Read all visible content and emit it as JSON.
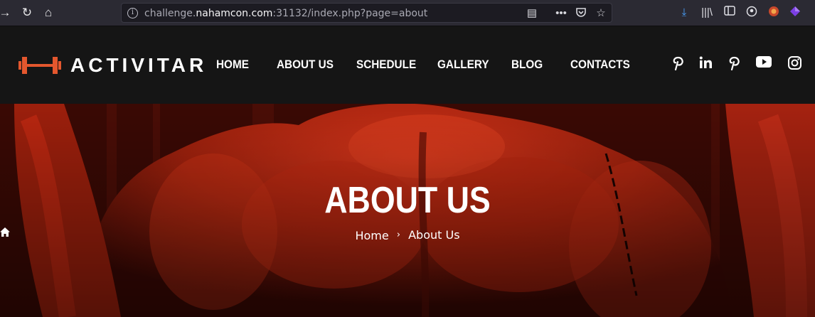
{
  "browser": {
    "url_prefix": "challenge.",
    "url_host": "nahamcon.com",
    "url_suffix": ":31132/index.php?page=about"
  },
  "site": {
    "logo_text": "ACTIVITAR",
    "nav": [
      "HOME",
      "ABOUT US",
      "SCHEDULE",
      "GALLERY",
      "BLOG",
      "CONTACTS"
    ],
    "social_icons": [
      "pinterest-icon",
      "linkedin-icon",
      "pinterest-icon",
      "youtube-icon",
      "instagram-icon"
    ],
    "accent_color": "#e4572e"
  },
  "hero": {
    "title": "ABOUT US",
    "breadcrumb_home": "Home",
    "breadcrumb_current": "About Us"
  }
}
